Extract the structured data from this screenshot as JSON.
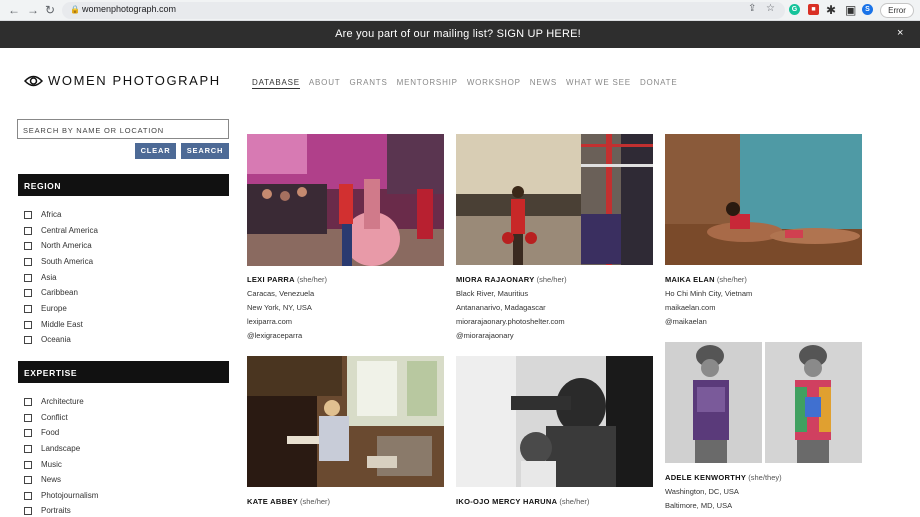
{
  "browser": {
    "url": "womenphotograph.com",
    "profile_initial": "S",
    "error_label": "Error"
  },
  "banner": {
    "message": "Are you part of our mailing list? SIGN UP HERE!",
    "close": "×"
  },
  "brand": {
    "name": "WOMEN PHOTOGRAPH"
  },
  "nav": {
    "items": [
      "DATABASE",
      "ABOUT",
      "GRANTS",
      "MENTORSHIP",
      "WORKSHOP",
      "NEWS",
      "WHAT WE SEE",
      "DONATE"
    ]
  },
  "search": {
    "placeholder": "SEARCH BY NAME OR LOCATION",
    "clear_label": "CLEAR",
    "search_label": "SEARCH"
  },
  "region": {
    "title": "REGION",
    "options": [
      "Africa",
      "Central America",
      "North America",
      "South America",
      "Asia",
      "Caribbean",
      "Europe",
      "Middle East",
      "Oceania"
    ]
  },
  "expertise": {
    "title": "EXPERTISE",
    "options": [
      "Architecture",
      "Conflict",
      "Food",
      "Landscape",
      "Music",
      "News",
      "Photojournalism",
      "Portraits"
    ]
  },
  "photographers": [
    {
      "name": "LEXI PARRA",
      "pronouns": "(she/her)",
      "lines": [
        "Caracas, Venezuela",
        "New York, NY, USA",
        "lexiparra.com",
        "@lexigraceparra"
      ]
    },
    {
      "name": "MIORA RAJAONARY",
      "pronouns": "(she/her)",
      "lines": [
        "Black River, Mauritius",
        "Antananarivo, Madagascar",
        "miorarajaonary.photoshelter.com",
        "@miorarajaonary"
      ]
    },
    {
      "name": "MAIKA ELAN",
      "pronouns": "(she/her)",
      "lines": [
        "Ho Chi Minh City, Vietnam",
        "maikaelan.com",
        "@maikaelan"
      ]
    },
    {
      "name": "KATE ABBEY",
      "pronouns": "(she/her)",
      "lines": []
    },
    {
      "name": "IKO-OJO MERCY HARUNA",
      "pronouns": "(she/her)",
      "lines": []
    },
    {
      "name": "ADELE KENWORTHY",
      "pronouns": "(she/they)",
      "lines": [
        "Washington, DC, USA",
        "Baltimore, MD, USA"
      ]
    }
  ],
  "colors": {
    "banner_bg": "#2e2e2e",
    "section_header_bg": "#111111",
    "button_bg": "#4d6a96"
  }
}
